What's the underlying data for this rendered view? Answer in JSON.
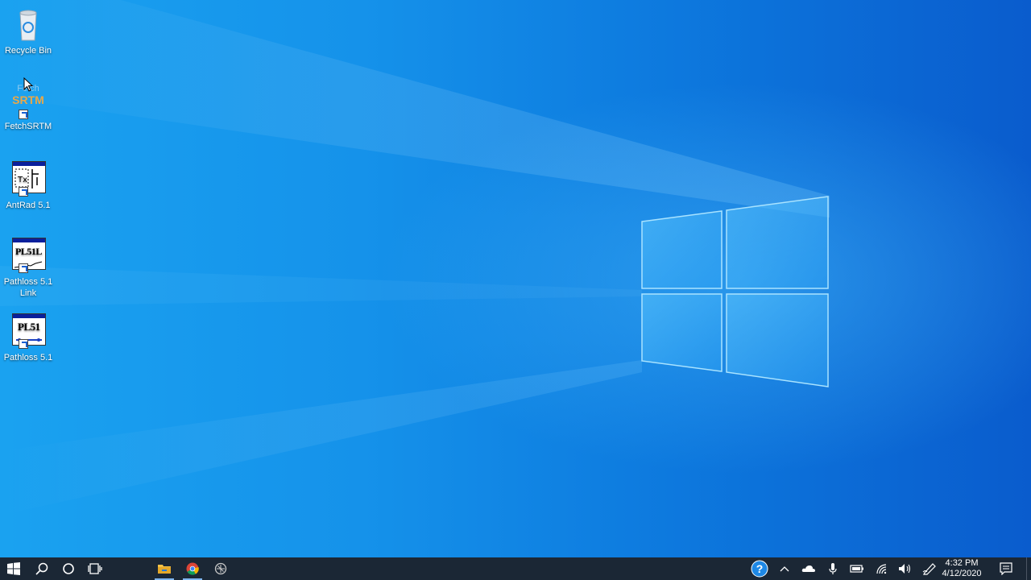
{
  "desktop": {
    "icons": [
      {
        "label": "Recycle Bin",
        "icon": "recycle-bin-icon"
      },
      {
        "label": "FetchSRTM",
        "icon": "fetchsrtm-icon",
        "graphic_text_top": "Fetch",
        "graphic_text_bottom": "SRTM"
      },
      {
        "label": "AntRad 5.1",
        "icon": "antrad-icon"
      },
      {
        "label": "Pathloss 5.1 Link",
        "icon": "pathloss-link-icon",
        "tile_text": "PL51L"
      },
      {
        "label": "Pathloss 5.1",
        "icon": "pathloss-icon",
        "tile_text": "PL51"
      }
    ]
  },
  "taskbar": {
    "start": "windows-start-icon",
    "search": "search-icon",
    "cortana": "cortana-icon",
    "task_view": "task-view-icon",
    "pinned": [
      "file-explorer-icon",
      "chrome-icon",
      "app-icon"
    ],
    "tray": [
      "help-icon",
      "chevron-up-icon",
      "onedrive-icon",
      "microphone-icon",
      "battery-icon",
      "wifi-icon",
      "volume-icon",
      "pen-icon"
    ],
    "time": "4:32 PM",
    "date": "4/12/2020",
    "notifications": "action-center-icon"
  },
  "colors": {
    "taskbar": "#1b2735",
    "accent": "#0a78d7",
    "logo": "#3db7ff"
  }
}
